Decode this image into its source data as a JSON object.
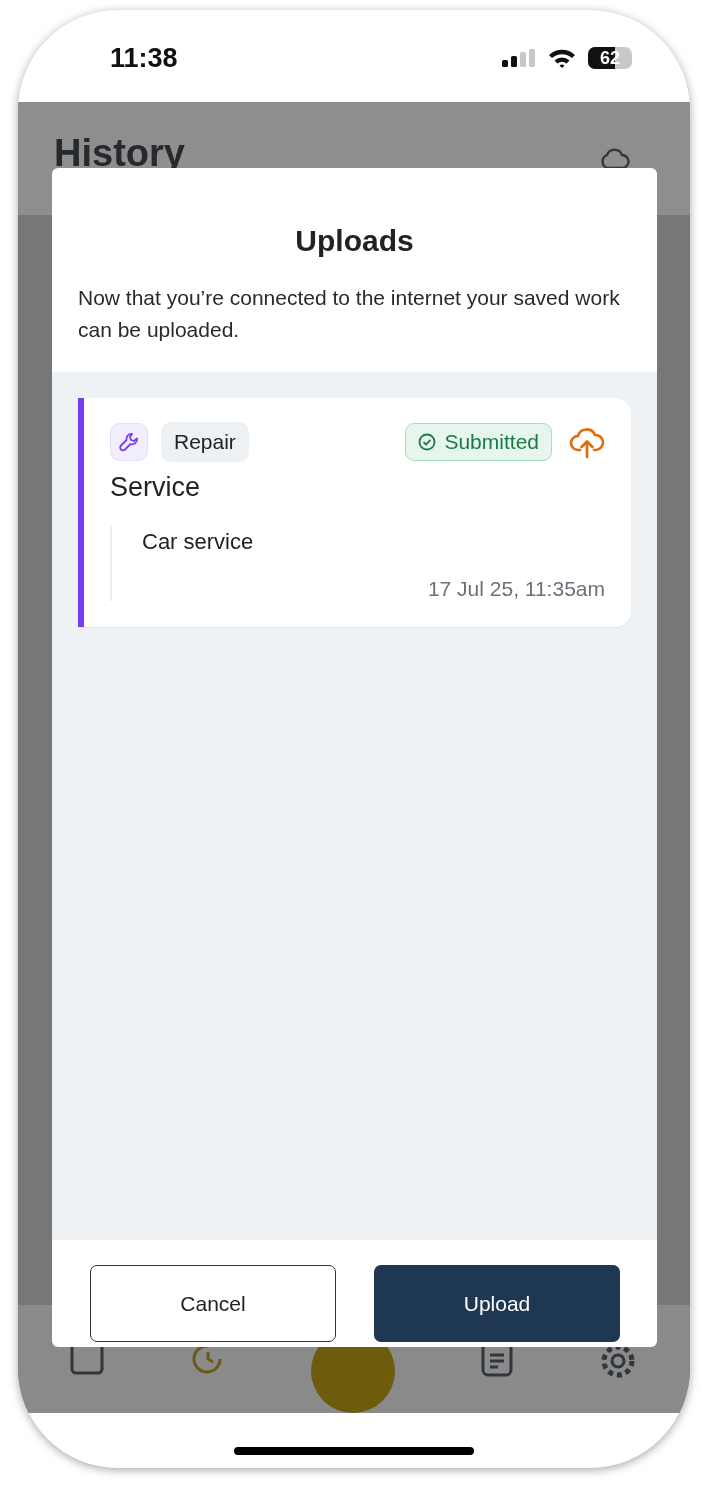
{
  "status_bar": {
    "time": "11:38",
    "battery": "62"
  },
  "background": {
    "title": "History"
  },
  "dialog": {
    "title": "Uploads",
    "message": "Now that you’re connected to the internet your saved work can be uploaded.",
    "uploads": [
      {
        "category": "Repair",
        "title": "Service",
        "status": "Submitted",
        "description": "Car service",
        "timestamp": "17 Jul 25, 11:35am",
        "color": "#7c3aed"
      }
    ],
    "buttons": [
      {
        "label": "Cancel",
        "kind": "secondary"
      },
      {
        "label": "Upload",
        "kind": "primary"
      }
    ]
  }
}
